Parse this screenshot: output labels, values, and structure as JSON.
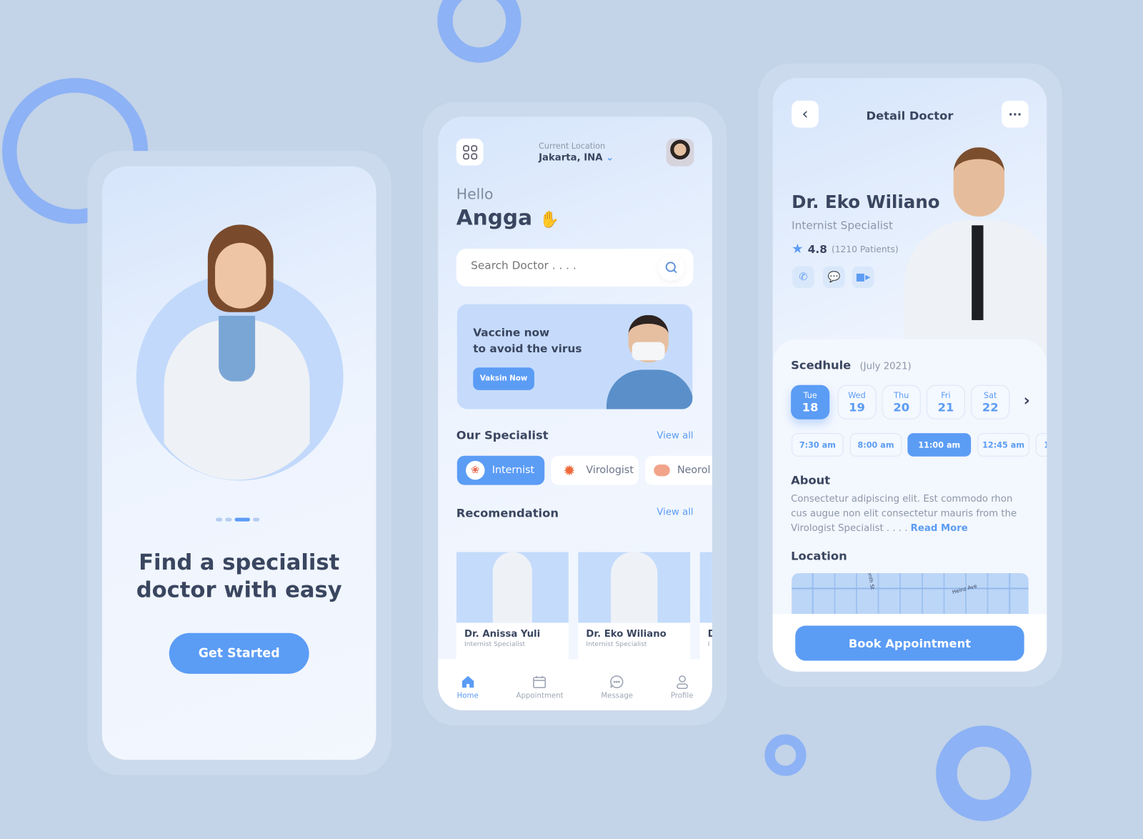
{
  "colors": {
    "accent": "#5b9cf5",
    "background": "#c3d3e8",
    "ring": "#8db2f5",
    "text_dark": "#3a4660"
  },
  "onboarding": {
    "title_line1": "Find a specialist",
    "title_line2": "doctor with easy",
    "cta": "Get Started",
    "pager": {
      "count": 4,
      "active": 2
    }
  },
  "home": {
    "menu_icon": "grid-icon",
    "location_label": "Current Location",
    "location_value": "Jakarta, INA",
    "greeting": "Hello",
    "user_name": "Angga",
    "wave_emoji": "✋",
    "search": {
      "placeholder": "Search Doctor . . . ."
    },
    "banner": {
      "line1": "Vaccine now",
      "line2": "to avoid the virus",
      "button": "Vaksin Now"
    },
    "specialist": {
      "title": "Our Specialist",
      "view_all": "View all",
      "items": [
        {
          "label": "Internist",
          "icon": "lungs-icon",
          "active": true
        },
        {
          "label": "Virologist",
          "icon": "virus-icon",
          "active": false
        },
        {
          "label": "Neorol",
          "icon": "brain-icon",
          "active": false
        }
      ]
    },
    "recommendation": {
      "title": "Recomendation",
      "view_all": "View all",
      "cards": [
        {
          "name": "Dr. Anissa Yuli",
          "specialty": "Internist Specialist"
        },
        {
          "name": "Dr. Eko Wiliano",
          "specialty": "Internist Specialist"
        },
        {
          "name": "D",
          "specialty": "I"
        }
      ]
    },
    "nav": [
      {
        "label": "Home",
        "icon": "home-icon",
        "active": true
      },
      {
        "label": "Appointment",
        "icon": "calendar-icon"
      },
      {
        "label": "Message",
        "icon": "chat-icon"
      },
      {
        "label": "Profile",
        "icon": "user-icon"
      }
    ]
  },
  "detail": {
    "title": "Detail Doctor",
    "more": "···",
    "back": "‹",
    "name": "Dr. Eko Wiliano",
    "specialty": "Internist Specialist",
    "rating": "4.8",
    "patients": "(1210 Patients)",
    "schedule_title": "Scedhule",
    "schedule_month": "(July 2021)",
    "days": [
      {
        "d": "Tue",
        "n": "18",
        "active": true
      },
      {
        "d": "Wed",
        "n": "19"
      },
      {
        "d": "Thu",
        "n": "20"
      },
      {
        "d": "Fri",
        "n": "21"
      },
      {
        "d": "Sat",
        "n": "22"
      }
    ],
    "times": [
      {
        "t": "7:30 am"
      },
      {
        "t": "8:00 am"
      },
      {
        "t": "11:00 am",
        "active": true
      },
      {
        "t": "12:45 am"
      },
      {
        "t": "1"
      }
    ],
    "about_title": "About",
    "about_text": "Consectetur adipiscing elit. Est commodo rhon cus augue non elit consectetur mauris from the Virologist Specialist . . . . ",
    "read_more": "Read More",
    "location_title": "Location",
    "map_labels": [
      "enth St",
      "Heinz Ave"
    ],
    "book": "Book Appointment"
  }
}
